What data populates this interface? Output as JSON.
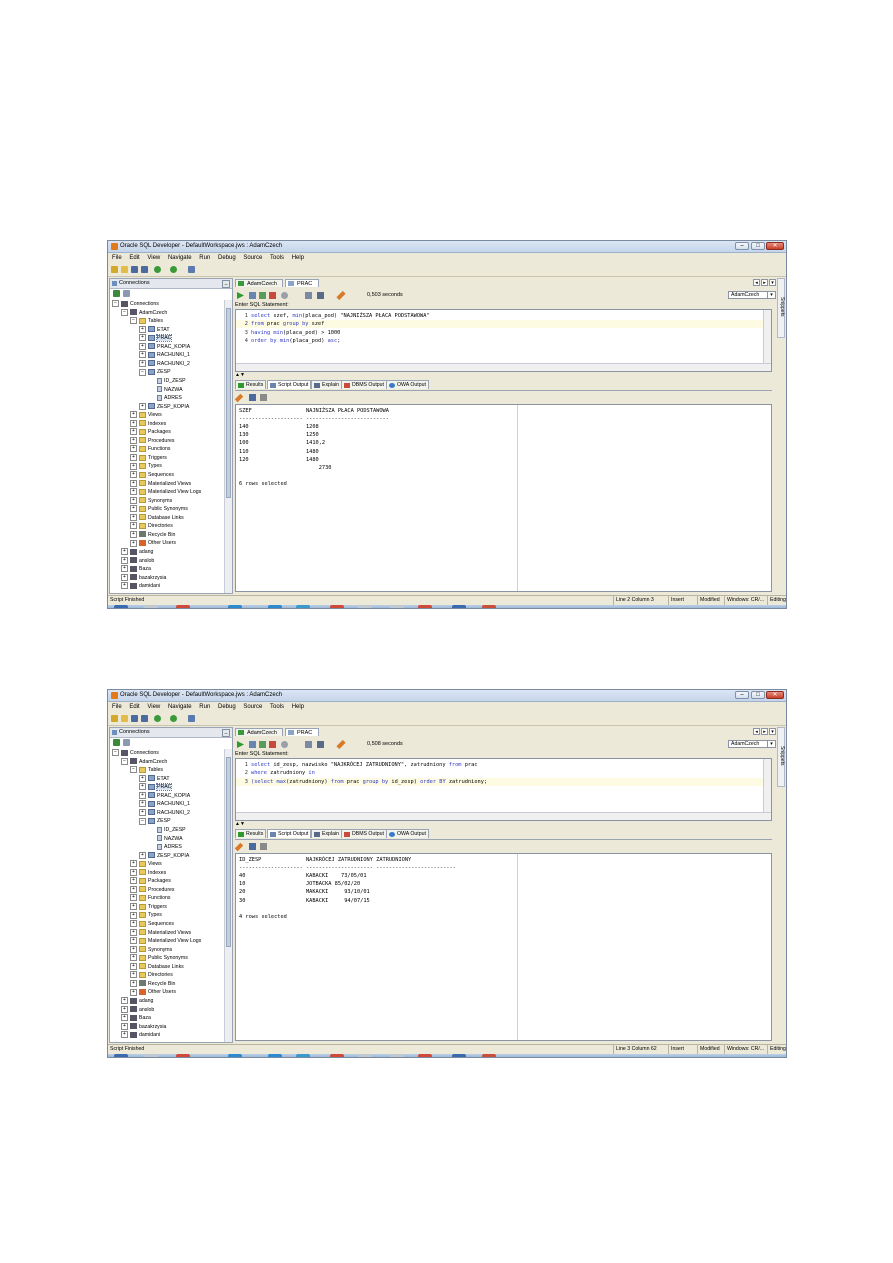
{
  "window_title": "Oracle SQL Developer - DefaultWorkspace.jws : AdamCzech",
  "menu": [
    "File",
    "Edit",
    "View",
    "Navigate",
    "Run",
    "Debug",
    "Source",
    "Tools",
    "Help"
  ],
  "window_buttons": {
    "minimize": "–",
    "maximize": "□",
    "close": "✕"
  },
  "connections_tab": "Connections",
  "tree": [
    {
      "label": "Connections",
      "level": 0,
      "type": "conn",
      "exp": "−"
    },
    {
      "label": "AdamCzech",
      "level": 1,
      "type": "conn",
      "exp": "−"
    },
    {
      "label": "Tables",
      "level": 2,
      "type": "fold",
      "exp": "−"
    },
    {
      "label": "ETAT",
      "level": 3,
      "type": "tbl",
      "exp": "+"
    },
    {
      "label": "PRAC",
      "level": 3,
      "type": "tbl",
      "exp": "+"
    },
    {
      "label": "PRAC_KOPIA",
      "level": 3,
      "type": "tbl",
      "exp": "+"
    },
    {
      "label": "RACHUNKI_1",
      "level": 3,
      "type": "tbl",
      "exp": "+"
    },
    {
      "label": "RACHUNKI_2",
      "level": 3,
      "type": "tbl",
      "exp": "+"
    },
    {
      "label": "ZESP",
      "level": 3,
      "type": "tbl",
      "exp": "−"
    },
    {
      "label": "ID_ZESP",
      "level": 4,
      "type": "col",
      "exp": ""
    },
    {
      "label": "NAZWA",
      "level": 4,
      "type": "col",
      "exp": ""
    },
    {
      "label": "ADRES",
      "level": 4,
      "type": "col",
      "exp": ""
    },
    {
      "label": "ZESP_KOPIA",
      "level": 3,
      "type": "tbl",
      "exp": "+"
    },
    {
      "label": "Views",
      "level": 2,
      "type": "fold",
      "exp": "+"
    },
    {
      "label": "Indexes",
      "level": 2,
      "type": "fold",
      "exp": "+"
    },
    {
      "label": "Packages",
      "level": 2,
      "type": "fold",
      "exp": "+"
    },
    {
      "label": "Procedures",
      "level": 2,
      "type": "fold",
      "exp": "+"
    },
    {
      "label": "Functions",
      "level": 2,
      "type": "fold",
      "exp": "+"
    },
    {
      "label": "Triggers",
      "level": 2,
      "type": "fold",
      "exp": "+"
    },
    {
      "label": "Types",
      "level": 2,
      "type": "fold",
      "exp": "+"
    },
    {
      "label": "Sequences",
      "level": 2,
      "type": "fold",
      "exp": "+"
    },
    {
      "label": "Materialized Views",
      "level": 2,
      "type": "fold",
      "exp": "+"
    },
    {
      "label": "Materialized View Logs",
      "level": 2,
      "type": "fold",
      "exp": "+"
    },
    {
      "label": "Synonyms",
      "level": 2,
      "type": "fold",
      "exp": "+"
    },
    {
      "label": "Public Synonyms",
      "level": 2,
      "type": "fold",
      "exp": "+"
    },
    {
      "label": "Database Links",
      "level": 2,
      "type": "fold",
      "exp": "+"
    },
    {
      "label": "Directories",
      "level": 2,
      "type": "fold",
      "exp": "+"
    },
    {
      "label": "Recycle Bin",
      "level": 2,
      "type": "bin",
      "exp": "+"
    },
    {
      "label": "Other Users",
      "level": 2,
      "type": "usr",
      "exp": "+"
    },
    {
      "label": "adang",
      "level": 1,
      "type": "conn",
      "exp": "+"
    },
    {
      "label": "anslob",
      "level": 1,
      "type": "conn",
      "exp": "+"
    },
    {
      "label": "Baza",
      "level": 1,
      "type": "conn",
      "exp": "+"
    },
    {
      "label": "bazakrzysia",
      "level": 1,
      "type": "conn",
      "exp": "+"
    },
    {
      "label": "damidani",
      "level": 1,
      "type": "conn",
      "exp": "+"
    }
  ],
  "doc_tabs": [
    "AdamCzech",
    "PRAC"
  ],
  "connection_select": "AdamCzech",
  "editor_label": "Enter SQL Statement:",
  "output_tabs": [
    "Results",
    "Script Output",
    "Explain",
    "DBMS Output",
    "OWA Output"
  ],
  "snippets_label": "Snippets",
  "status": {
    "mode": "Insert",
    "modified": "Modified",
    "encoding": "Windows: CR/...",
    "editing": "Editing"
  },
  "shots": [
    {
      "timing": "0,503 seconds",
      "sql": [
        [
          {
            "t": "select",
            "k": 1
          },
          {
            "t": " szef, "
          },
          {
            "t": "min",
            "k": 1
          },
          {
            "t": "(placa_pod) \"NAJNIŻSZA PŁACA PODSTAWOWA\""
          }
        ],
        [
          {
            "t": "from",
            "k": 1
          },
          {
            "t": " prac "
          },
          {
            "t": "group",
            "k": 1
          },
          {
            "t": " "
          },
          {
            "t": "by",
            "k": 1
          },
          {
            "t": " szef"
          }
        ],
        [
          {
            "t": "having",
            "k": 1
          },
          {
            "t": " "
          },
          {
            "t": "min",
            "k": 1
          },
          {
            "t": "(placa_pod) > 1000"
          }
        ],
        [
          {
            "t": "order",
            "k": 1
          },
          {
            "t": " "
          },
          {
            "t": "by",
            "k": 1
          },
          {
            "t": " "
          },
          {
            "t": "min",
            "k": 1
          },
          {
            "t": "(placa_pod) "
          },
          {
            "t": "asc",
            "k": 1
          },
          {
            "t": ";"
          }
        ]
      ],
      "sql_lines": [
        "1",
        "2",
        "3",
        "4"
      ],
      "current_line": 1,
      "output": [
        "SZEF                 NAJNIŻSZA PŁACA PODSTAWOWA",
        "-------------------- --------------------------",
        "140                  1208",
        "130                  1250",
        "100                  1410,2",
        "110                  1480",
        "120                  1480",
        "                         2730",
        "",
        "6 rows selected"
      ],
      "status_msg": "Script Finished",
      "status_pos": "Line 2 Column 3"
    },
    {
      "timing": "0,508 seconds",
      "sql": [
        [
          {
            "t": "select",
            "k": 1
          },
          {
            "t": " id_zesp, nazwisko \"NAJKRÓCEJ ZATRUDNIONY\", zatrudniony "
          },
          {
            "t": "from",
            "k": 1
          },
          {
            "t": " prac"
          }
        ],
        [
          {
            "t": "where",
            "k": 1
          },
          {
            "t": " zatrudniony "
          },
          {
            "t": "in",
            "k": 1
          }
        ],
        [
          {
            "t": "(select ",
            "k": 1
          },
          {
            "t": "max",
            "k": 1
          },
          {
            "t": "(zatrudniony) "
          },
          {
            "t": "from",
            "k": 1
          },
          {
            "t": " prac "
          },
          {
            "t": "group",
            "k": 1
          },
          {
            "t": " "
          },
          {
            "t": "by",
            "k": 1
          },
          {
            "t": " id_zesp) "
          },
          {
            "t": "order",
            "k": 1
          },
          {
            "t": " "
          },
          {
            "t": "BY",
            "k": 1
          },
          {
            "t": " zatrudniony;"
          }
        ]
      ],
      "sql_lines": [
        "1",
        "2",
        "3"
      ],
      "current_line": 2,
      "output": [
        "ID_ZESP              NAJKRÓCEJ ZATRUDNIONY ZATRUDNIONY",
        "-------------------- --------------------- -------------------------",
        "40                   KABACKI    73/05/01",
        "10                   JOTBACKA 85/02/20",
        "20                   MAKACKI     93/10/01",
        "30                   KABACKI     94/07/15",
        "",
        "4 rows selected"
      ],
      "status_msg": "Script Finished",
      "status_pos": "Line 3 Column 62"
    }
  ]
}
